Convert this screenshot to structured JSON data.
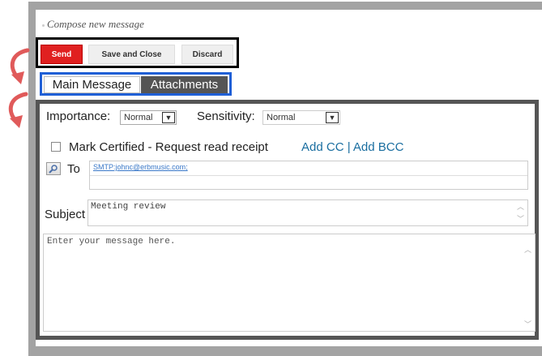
{
  "compose": {
    "title": "Compose new message"
  },
  "toolbar": {
    "send_label": "Send",
    "save_label": "Save and Close",
    "discard_label": "Discard"
  },
  "tabs": [
    {
      "label": "Main Message"
    },
    {
      "label": "Attachments"
    }
  ],
  "form": {
    "importance_label": "Importance:",
    "importance_value": "Normal",
    "sensitivity_label": "Sensitivity:",
    "sensitivity_value": "Normal",
    "certified_label": "Mark Certified - Request read receipt",
    "add_cc_label": "Add CC | Add BCC",
    "to_label": "To",
    "to_value": "SMTP:johnc@erbmusic.com;",
    "subject_label": "Subject",
    "subject_value": "Meeting review",
    "body_placeholder": "Enter your message here."
  },
  "colors": {
    "send": "#e02020",
    "tab_active_border": "#1f5fd6",
    "link": "#1a6ea0",
    "frame": "#a3a3a3"
  }
}
